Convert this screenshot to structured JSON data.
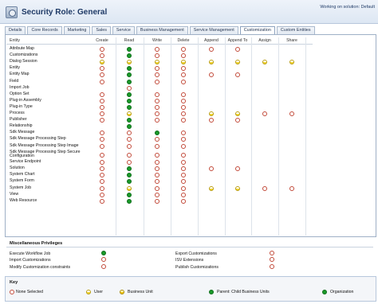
{
  "window": {
    "title": "Security Role: General",
    "solution": "Working on solution: Default"
  },
  "tabs": [
    "Details",
    "Core Records",
    "Marketing",
    "Sales",
    "Service",
    "Business Management",
    "Service Management",
    "Customization",
    "Custom Entities"
  ],
  "active_tab": "Customization",
  "columns": {
    "entity": "Entity",
    "create": "Create",
    "read": "Read",
    "write": "Write",
    "delete": "Delete",
    "append": "Append",
    "append_to": "Append To",
    "assign": "Assign",
    "share": "Share"
  },
  "entities": [
    {
      "name": "Attribute Map",
      "p": [
        "none",
        "org",
        "none",
        "none",
        "none",
        "none",
        "",
        ""
      ]
    },
    {
      "name": "Customizations",
      "p": [
        "none",
        "org",
        "none",
        "none",
        "",
        "",
        "",
        ""
      ]
    },
    {
      "name": "Dialog Session",
      "p": [
        "user",
        "user",
        "user",
        "user",
        "user",
        "user",
        "user",
        "user"
      ]
    },
    {
      "name": "Entity",
      "p": [
        "none",
        "org",
        "none",
        "none",
        "",
        "",
        "",
        ""
      ]
    },
    {
      "name": "Entity Map",
      "p": [
        "none",
        "org",
        "none",
        "none",
        "none",
        "none",
        "",
        ""
      ]
    },
    {
      "name": "Field",
      "p": [
        "none",
        "org",
        "none",
        "none",
        "",
        "",
        "",
        ""
      ]
    },
    {
      "name": "Import Job",
      "p": [
        "",
        "none",
        "",
        "",
        "",
        "",
        "",
        ""
      ]
    },
    {
      "name": "Option Set",
      "p": [
        "none",
        "org",
        "none",
        "none",
        "",
        "",
        "",
        ""
      ]
    },
    {
      "name": "Plug-in Assembly",
      "p": [
        "none",
        "org",
        "none",
        "none",
        "",
        "",
        "",
        ""
      ]
    },
    {
      "name": "Plug-in Type",
      "p": [
        "none",
        "org",
        "none",
        "none",
        "",
        "",
        "",
        ""
      ]
    },
    {
      "name": "Process",
      "p": [
        "none",
        "user",
        "none",
        "none",
        "user",
        "user",
        "none",
        "none"
      ]
    },
    {
      "name": "Publisher",
      "p": [
        "none",
        "org",
        "none",
        "none",
        "none",
        "none",
        "",
        ""
      ]
    },
    {
      "name": "Relationship",
      "p": [
        "",
        "org",
        "",
        "",
        "",
        "",
        "",
        ""
      ]
    },
    {
      "name": "Sdk Message",
      "p": [
        "none",
        "none",
        "org",
        "none",
        "",
        "",
        "",
        ""
      ]
    },
    {
      "name": "Sdk Message Processing Step",
      "p": [
        "none",
        "none",
        "none",
        "none",
        "",
        "",
        "",
        ""
      ]
    },
    {
      "name": "Sdk Message Processing Step Image",
      "p": [
        "none",
        "none",
        "none",
        "none",
        "",
        "",
        "",
        ""
      ]
    },
    {
      "name": "Sdk Message Processing Step Secure Configuration",
      "p": [
        "none",
        "none",
        "none",
        "none",
        "",
        "",
        "",
        ""
      ]
    },
    {
      "name": "Service Endpoint",
      "p": [
        "none",
        "none",
        "none",
        "none",
        "",
        "",
        "",
        ""
      ]
    },
    {
      "name": "Solution",
      "p": [
        "none",
        "org",
        "none",
        "none",
        "none",
        "none",
        "",
        ""
      ]
    },
    {
      "name": "System Chart",
      "p": [
        "none",
        "org",
        "none",
        "none",
        "",
        "",
        "",
        ""
      ]
    },
    {
      "name": "System Form",
      "p": [
        "none",
        "org",
        "none",
        "none",
        "",
        "",
        "",
        ""
      ]
    },
    {
      "name": "System Job",
      "p": [
        "none",
        "user",
        "none",
        "none",
        "user",
        "user",
        "none",
        "none"
      ]
    },
    {
      "name": "View",
      "p": [
        "none",
        "org",
        "none",
        "none",
        "",
        "",
        "",
        ""
      ]
    },
    {
      "name": "Web Resource",
      "p": [
        "none",
        "org",
        "none",
        "none",
        "",
        "",
        "",
        ""
      ]
    }
  ],
  "misc": {
    "title": "Miscellaneous Privileges",
    "items": [
      {
        "label": "Execute Workflow Job",
        "level": "org"
      },
      {
        "label": "Import Customizations",
        "level": "none"
      },
      {
        "label": "Modify Customization constraints",
        "level": "none"
      },
      {
        "label": "Export Customizations",
        "level": "none"
      },
      {
        "label": "ISV Extensions",
        "level": "none"
      },
      {
        "label": "Publish Customizations",
        "level": "none"
      }
    ]
  },
  "key": {
    "title": "Key",
    "items": [
      {
        "label": "None Selected",
        "level": "none"
      },
      {
        "label": "User",
        "level": "user"
      },
      {
        "label": "Business Unit",
        "level": "bu"
      },
      {
        "label": "Parent: Child Business Units",
        "level": "org"
      },
      {
        "label": "Organization",
        "level": "org"
      }
    ]
  },
  "colors": {
    "header_bg": "#dde7f3",
    "title": "#1f3a66",
    "organization": "#1a9a2a",
    "user": "#f3d633",
    "none": "#c24a3a"
  }
}
